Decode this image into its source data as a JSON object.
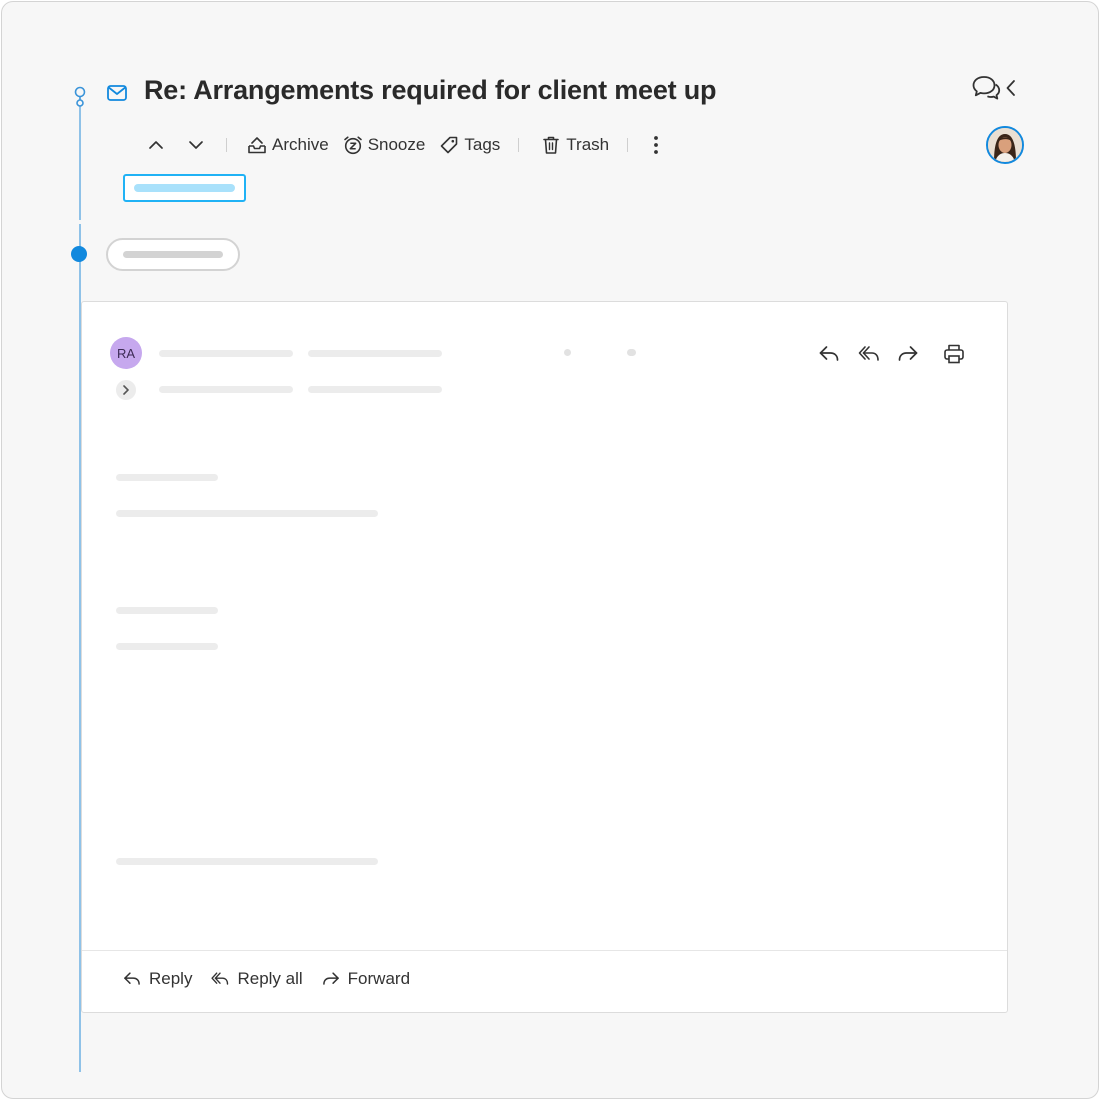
{
  "thread": {
    "subject": "Re: Arrangements required for client meet up"
  },
  "toolbar": {
    "archive_label": "Archive",
    "snooze_label": "Snooze",
    "tags_label": "Tags",
    "trash_label": "Trash"
  },
  "message": {
    "sender_initials": "RA"
  },
  "footer": {
    "reply_label": "Reply",
    "reply_all_label": "Reply all",
    "forward_label": "Forward"
  },
  "icons": {
    "header": [
      "timeline-pin-icon",
      "mail-icon",
      "chat-bubbles-icon",
      "collapse-left-icon"
    ],
    "toolbar": [
      "chevron-up-icon",
      "chevron-down-icon",
      "archive-icon",
      "snooze-clock-icon",
      "tag-icon",
      "trash-icon",
      "more-vertical-icon"
    ],
    "message_actions": [
      "reply-icon",
      "reply-all-icon",
      "forward-icon",
      "print-icon"
    ]
  },
  "colors": {
    "accent": "#1289de",
    "timeline": "#8fc2e8",
    "selection_border": "#20b2f5",
    "initials_avatar": "#c6a8ee",
    "skeleton": "#ececec"
  }
}
